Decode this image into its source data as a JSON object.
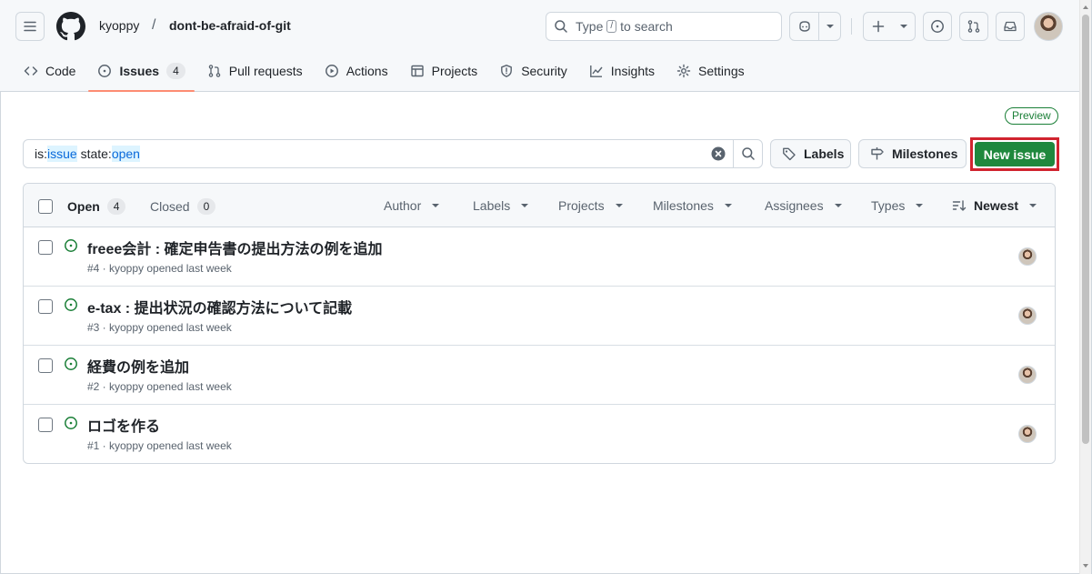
{
  "header": {
    "owner": "kyoppy",
    "separator": "/",
    "repo": "dont-be-afraid-of-git",
    "search": {
      "prefix": "Type",
      "key": "/",
      "suffix": "to search"
    }
  },
  "nav": {
    "code": "Code",
    "issues": "Issues",
    "issues_count": "4",
    "pull_requests": "Pull requests",
    "actions": "Actions",
    "projects": "Projects",
    "security": "Security",
    "insights": "Insights",
    "settings": "Settings"
  },
  "preview_badge": "Preview",
  "filter": {
    "is_key": "is:",
    "is_value": "issue",
    "state_key": "state:",
    "state_value": "open"
  },
  "buttons": {
    "labels": "Labels",
    "milestones": "Milestones",
    "new_issue": "New issue"
  },
  "list_header": {
    "open_label": "Open",
    "open_count": "4",
    "closed_label": "Closed",
    "closed_count": "0",
    "author": "Author",
    "labels": "Labels",
    "projects": "Projects",
    "milestones": "Milestones",
    "assignees": "Assignees",
    "types": "Types",
    "sort": "Newest"
  },
  "issues": [
    {
      "title": "freee会計 : 確定申告書の提出方法の例を追加",
      "meta": "#4 · kyoppy opened last week"
    },
    {
      "title": "e-tax : 提出状況の確認方法について記載",
      "meta": "#3 · kyoppy opened last week"
    },
    {
      "title": "経費の例を追加",
      "meta": "#2 · kyoppy opened last week"
    },
    {
      "title": "ロゴを作る",
      "meta": "#1 · kyoppy opened last week"
    }
  ],
  "colors": {
    "accent_green": "#1f883d",
    "open_icon": "#1a7f37",
    "highlight_border": "#d1242f",
    "nav_underline": "#fd8c73"
  }
}
